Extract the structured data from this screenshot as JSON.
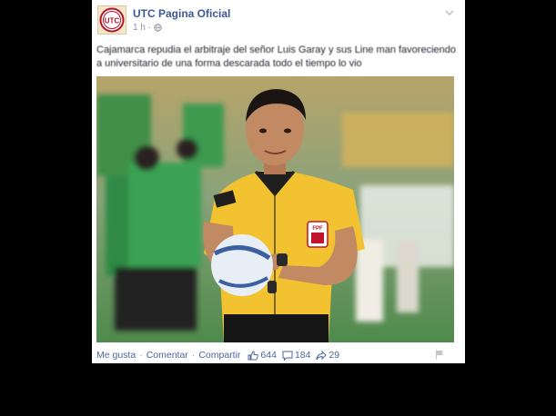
{
  "post": {
    "page_name": "UTC Pagina Oficial",
    "time": "1 h",
    "avatar_text": "UTC",
    "text": "Cajamarca repudia el arbitraje del señor Luis Garay y sus Line man favoreciendo a universitario de una forma descarada todo el tiempo lo vio",
    "photo_alt": "Referee in yellow jersey holding a football, cheerleaders in green behind",
    "referee_badge": "FPF"
  },
  "actions": {
    "like_label": "Me gusta",
    "comment_label": "Comentar",
    "share_label": "Compartir",
    "likes": "644",
    "comments": "184",
    "shares": "29"
  },
  "icons": {
    "globe": "globe-icon",
    "chevron": "chevron-down-icon",
    "like": "thumbs-up-icon",
    "comment": "comment-icon",
    "share": "share-icon",
    "flag": "flag-icon"
  },
  "colors": {
    "brand_link": "#3b5998",
    "jersey": "#f2c230",
    "field": "#5a8a52"
  }
}
